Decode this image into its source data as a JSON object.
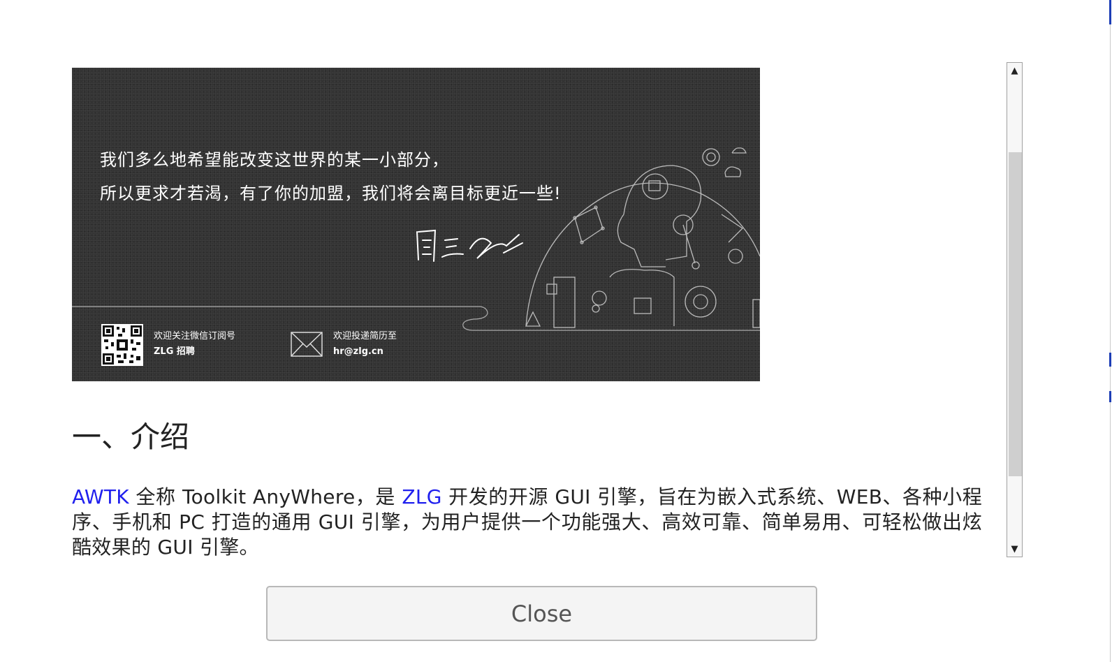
{
  "banner": {
    "line1": "我们多么地希望能改变这世界的某一小部分，",
    "line2": "所以更求才若渴，有了你的加盟，我们将会离目标更近一些!",
    "wechat_label": "欢迎关注微信订阅号",
    "wechat_account": "ZLG 招聘",
    "email_label": "欢迎投递简历至",
    "email_address": "hr@zlg.cn"
  },
  "section": {
    "heading": "一、介绍"
  },
  "intro": {
    "link1": "AWTK",
    "text1": " 全称 Toolkit AnyWhere，是 ",
    "link2": "ZLG",
    "text2": " 开发的开源 GUI 引擎，旨在为嵌入式系统、WEB、各种小程序、手机和 PC 打造的通用 GUI 引擎，为用户提供一个功能强大、高效可靠、简单易用、可轻松做出炫酷效果的 GUI 引擎。"
  },
  "scrollbar": {
    "up_glyph": "▲",
    "down_glyph": "▼"
  },
  "close_button": {
    "label": "Close"
  },
  "colors": {
    "link": "#2020ee",
    "banner_bg": "#333333",
    "text": "#222222"
  }
}
